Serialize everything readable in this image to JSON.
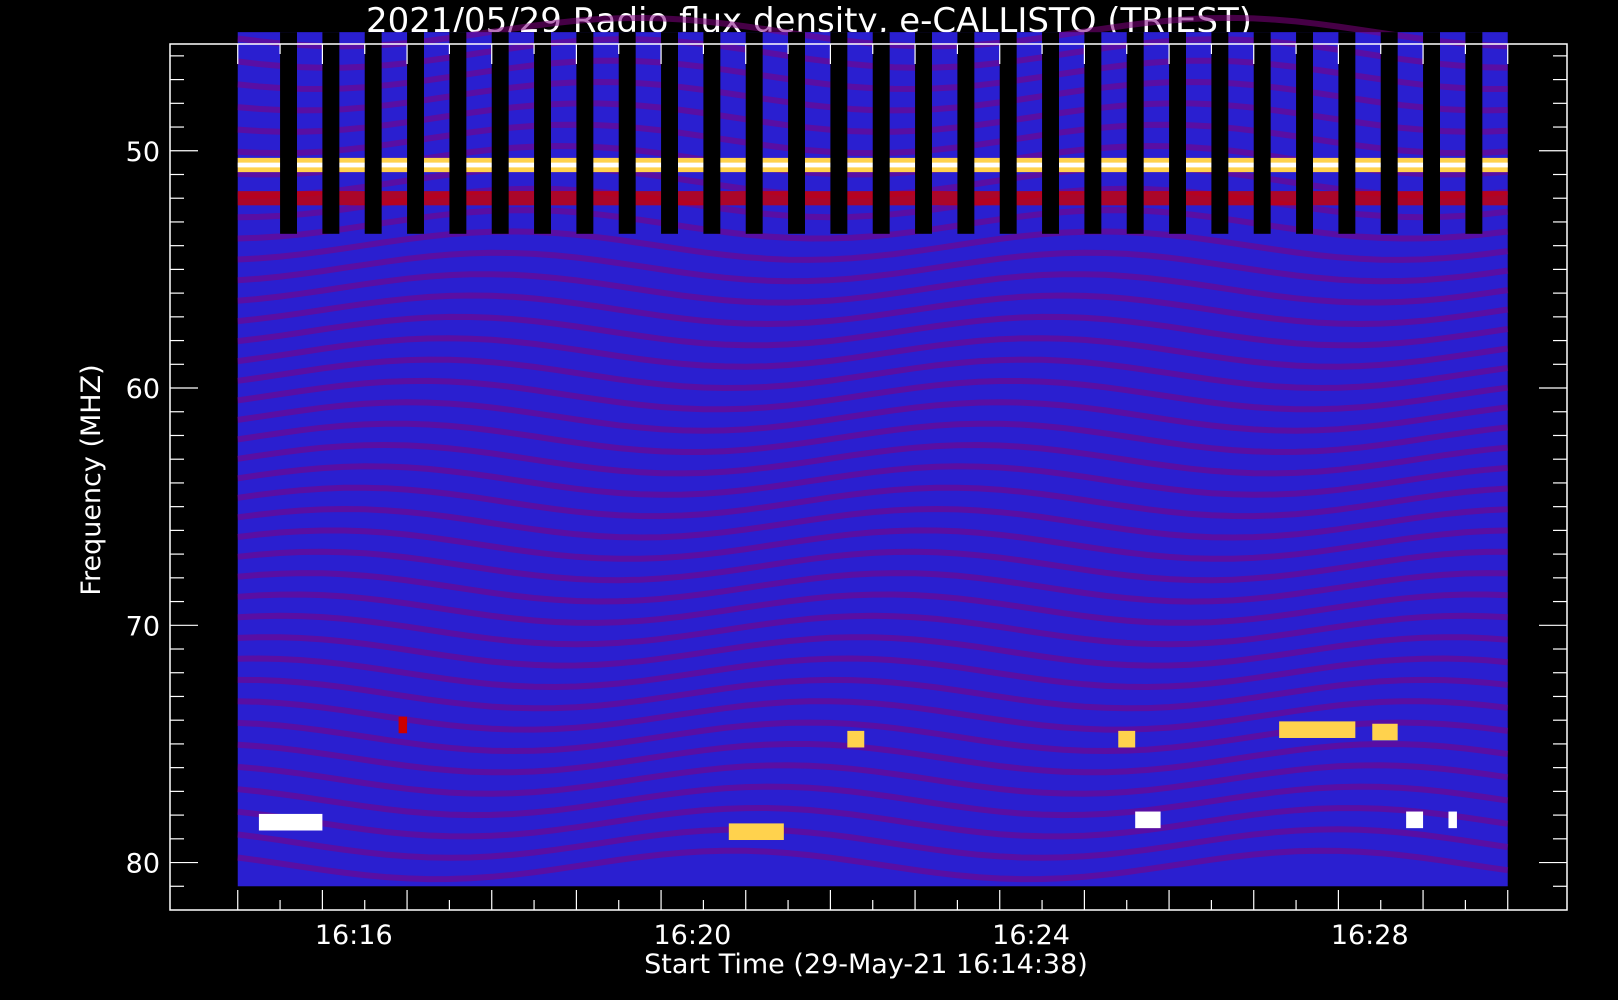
{
  "chart_data": {
    "type": "heatmap",
    "title": "2021/05/29  Radio flux density, e-CALLISTO (TRIEST)",
    "xlabel": "Start Time (29-May-21 16:14:38)",
    "ylabel": "Frequency (MHZ)",
    "x_axis": {
      "unit": "minutes since 16:14:38",
      "range": [
        -0.8,
        15.7
      ],
      "data_range": [
        0,
        15.0
      ],
      "major_ticks": [
        {
          "value": 1.37,
          "label": "16:16"
        },
        {
          "value": 5.37,
          "label": "16:20"
        },
        {
          "value": 9.37,
          "label": "16:24"
        },
        {
          "value": 13.37,
          "label": "16:28"
        }
      ]
    },
    "y_axis": {
      "range": [
        45.5,
        82.0
      ],
      "data_range": [
        45.0,
        81.0
      ],
      "inverted": true,
      "major_ticks": [
        {
          "value": 50,
          "label": "50"
        },
        {
          "value": 60,
          "label": "60"
        },
        {
          "value": 70,
          "label": "70"
        },
        {
          "value": 80,
          "label": "80"
        }
      ]
    },
    "colormap": [
      "#0000ff",
      "#800080",
      "#cc0000",
      "#ffd24d",
      "#ffffff"
    ],
    "background": "#2a1fd0",
    "features": {
      "gap_columns": 29,
      "gap_freq_range": [
        45.0,
        53.5
      ],
      "bright_band_mhz": 50.6,
      "red_band_mhz": 52.0,
      "bursts": [
        {
          "t0": 0.25,
          "t1": 1.0,
          "f": 78.3,
          "level": "white"
        },
        {
          "t0": 5.8,
          "t1": 6.45,
          "f": 78.7,
          "level": "yellow"
        },
        {
          "t0": 12.3,
          "t1": 13.2,
          "f": 74.4,
          "level": "yellow"
        },
        {
          "t0": 13.4,
          "t1": 13.7,
          "f": 74.5,
          "level": "yellow"
        },
        {
          "t0": 1.9,
          "t1": 2.0,
          "f": 74.2,
          "level": "red"
        },
        {
          "t0": 7.2,
          "t1": 7.4,
          "f": 74.8,
          "level": "yellow"
        },
        {
          "t0": 10.4,
          "t1": 10.6,
          "f": 74.8,
          "level": "yellow"
        },
        {
          "t0": 10.6,
          "t1": 10.9,
          "f": 78.2,
          "level": "white"
        },
        {
          "t0": 13.8,
          "t1": 14.0,
          "f": 78.2,
          "level": "white"
        },
        {
          "t0": 14.3,
          "t1": 14.4,
          "f": 78.2,
          "level": "white"
        }
      ]
    }
  }
}
